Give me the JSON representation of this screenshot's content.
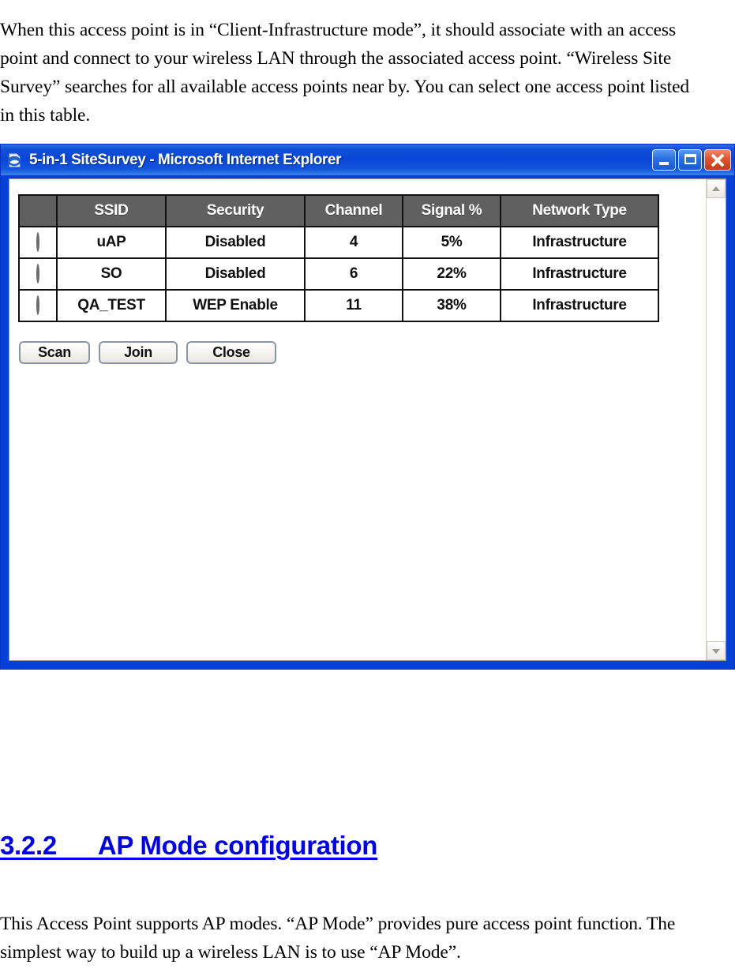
{
  "document": {
    "intro_paragraph": "When this access point is in “Client-Infrastructure mode”, it should associate with an access point and connect to your wireless LAN through the associated access point. “Wireless Site Survey” searches for all available access points near by. You can select one access point listed in this table.",
    "section_heading": "3.2.2      AP Mode configuration",
    "closing_paragraph": "This Access Point supports AP modes. “AP Mode” provides pure access point function. The simplest way to build up a wireless LAN is to use “AP Mode”."
  },
  "window": {
    "title": "5-in-1 SiteSurvey - Microsoft Internet Explorer",
    "app_icon": "internet-explorer-icon",
    "controls": {
      "minimize": "minimize-button",
      "maximize": "maximize-button",
      "close": "close-button"
    },
    "title_bar_color": "#0a46d6",
    "border_color": "#0540d8"
  },
  "scrollbar": {
    "up_arrow": "scroll-up-arrow",
    "down_arrow": "scroll-down-arrow"
  },
  "survey_table": {
    "header_background": "#606060",
    "columns": [
      "",
      "SSID",
      "Security",
      "Channel",
      "Signal %",
      "Network Type"
    ],
    "rows": [
      {
        "selected": false,
        "ssid": "uAP",
        "security": "Disabled",
        "channel": "4",
        "signal": "5%",
        "network_type": "Infrastructure"
      },
      {
        "selected": false,
        "ssid": "SO",
        "security": "Disabled",
        "channel": "6",
        "signal": "22%",
        "network_type": "Infrastructure"
      },
      {
        "selected": false,
        "ssid": "QA_TEST",
        "security": "WEP Enable",
        "channel": "11",
        "signal": "38%",
        "network_type": "Infrastructure"
      }
    ]
  },
  "buttons": {
    "scan": "Scan",
    "join": "Join",
    "close": "Close"
  }
}
